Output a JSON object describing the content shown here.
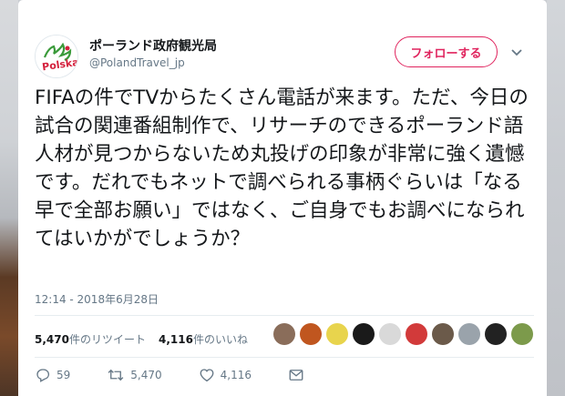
{
  "author": {
    "name": "ポーランド政府観光局",
    "handle": "@PolandTravel_jp",
    "avatar_text": "Polska"
  },
  "follow_button": {
    "label": "フォローする"
  },
  "tweet": {
    "text": "FIFAの件でTVからたくさん電話が来ます。ただ、今日の試合の関連番組制作で、リサーチのできるポーランド語人材が見つからないため丸投げの印象が非常に強く遺憾です。だれでもネットで調べられる事柄ぐらいは「なる早で全部お願い」ではなく、ご自身でもお調べになられてはいかがでしょうか？",
    "timestamp": "12:14 - 2018年6月28日"
  },
  "stats": {
    "retweets_count": "5,470",
    "retweets_label": "件のリツイート",
    "likes_count": "4,116",
    "likes_label": "件のいいね"
  },
  "actions": {
    "reply_count": "59",
    "retweet_count": "5,470",
    "like_count": "4,116"
  },
  "likers": [
    {
      "color": "#8a6d5a"
    },
    {
      "color": "#c0561f"
    },
    {
      "color": "#e8d44d"
    },
    {
      "color": "#1a1a1a"
    },
    {
      "color": "#d9d9d9"
    },
    {
      "color": "#d23a3a"
    },
    {
      "color": "#6b5a4a"
    },
    {
      "color": "#9aa3ab"
    },
    {
      "color": "#222222"
    },
    {
      "color": "#7c9a4b"
    }
  ],
  "colors": {
    "accent": "#e0245e",
    "secondary_text": "#657786",
    "primary_text": "#14171a"
  }
}
